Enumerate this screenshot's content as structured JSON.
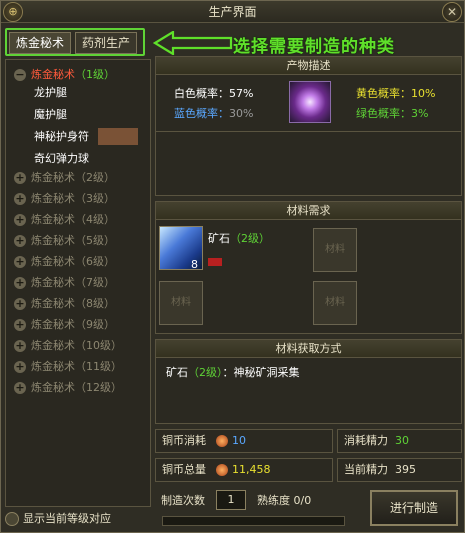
{
  "window": {
    "title": "生产界面",
    "logo_glyph": "⊕",
    "close_glyph": "✕"
  },
  "tabs": [
    {
      "label": "炼金秘术",
      "active": true
    },
    {
      "label": "药剂生产",
      "active": false
    }
  ],
  "annotation": {
    "text": "选择需要制造的种类",
    "color": "#5fe02a"
  },
  "recipe_list": {
    "open_category": {
      "name": "炼金秘术",
      "level": "（1级）",
      "toggle": "−"
    },
    "sub_items": [
      "龙护腿",
      "魔护腿",
      "神秘护身符",
      "奇幻弹力球"
    ],
    "categories": [
      {
        "name": "炼金秘术",
        "level": "（2级）"
      },
      {
        "name": "炼金秘术",
        "level": "（3级）"
      },
      {
        "name": "炼金秘术",
        "level": "（4级）"
      },
      {
        "name": "炼金秘术",
        "level": "（5级）"
      },
      {
        "name": "炼金秘术",
        "level": "（6级）"
      },
      {
        "name": "炼金秘术",
        "level": "（7级）"
      },
      {
        "name": "炼金秘术",
        "level": "（8级）"
      },
      {
        "name": "炼金秘术",
        "level": "（9级）"
      },
      {
        "name": "炼金秘术",
        "level": "（10级）"
      },
      {
        "name": "炼金秘术",
        "level": "（11级）"
      },
      {
        "name": "炼金秘术",
        "level": "（12级）"
      }
    ],
    "collapsed_toggle": "+"
  },
  "show_level_checkbox": {
    "label": "显示当前等级对应"
  },
  "product": {
    "header": "产物描述",
    "rates": {
      "white": {
        "label": "白色概率：",
        "value": "57%",
        "color": "#ffffff"
      },
      "yellow": {
        "label": "黄色概率：",
        "value": "10%",
        "color": "#e8e030"
      },
      "blue": {
        "label": "蓝色概率：",
        "value": "30%",
        "color": "#5aa8ff"
      },
      "green": {
        "label": "绿色概率：",
        "value": "3%",
        "color": "#5fd336"
      }
    }
  },
  "materials": {
    "header": "材料需求",
    "item_name": "矿石",
    "item_level": "（2级）",
    "item_count": "8",
    "empty_label": "材料"
  },
  "source": {
    "header": "材料获取方式",
    "item": "矿石",
    "item_level": "（2级）",
    "method": "：神秘矿洞采集"
  },
  "stats": {
    "coin_cost_label": "铜币消耗",
    "coin_cost_value": "10",
    "energy_cost_label": "消耗精力",
    "energy_cost_value": "30",
    "coin_total_label": "铜币总量",
    "coin_total_value": "11,458",
    "energy_current_label": "当前精力",
    "energy_current_value": "395"
  },
  "craft": {
    "count_label": "制造次数",
    "count_value": "1",
    "proficiency_label": "熟练度",
    "proficiency_value": "0/0",
    "button_label": "进行制造"
  },
  "colors": {
    "accent_green": "#5fd336",
    "open_category_red": "#ff5a3c",
    "need_red": "#ff3030"
  }
}
